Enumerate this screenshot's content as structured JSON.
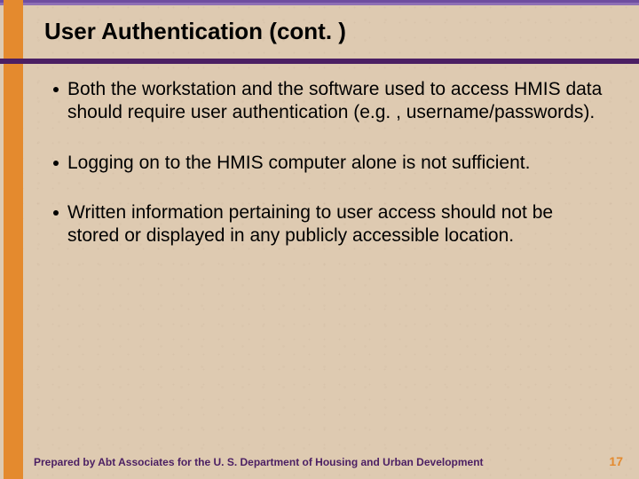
{
  "title": "User Authentication (cont. )",
  "bullets": [
    "Both the workstation and the software used to access HMIS data should require user authentication (e.g. , username/passwords).",
    "Logging on to the HMIS computer alone is not sufficient.",
    "Written information pertaining to user access should not be stored or displayed in any publicly accessible location."
  ],
  "footer": "Prepared by Abt Associates for the U. S. Department of Housing and Urban Development",
  "page_number": "17"
}
